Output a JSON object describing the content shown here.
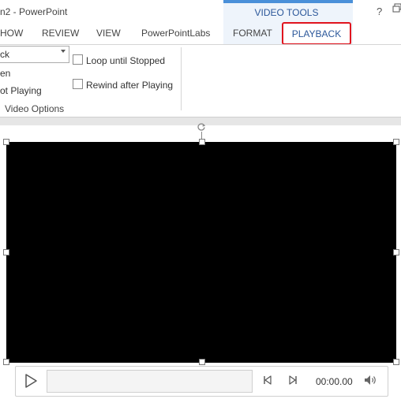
{
  "window": {
    "title": "n2 - PowerPoint",
    "contextual_group": "VIDEO TOOLS",
    "help": "?"
  },
  "tabs": [
    {
      "label": "HOW"
    },
    {
      "label": "REVIEW"
    },
    {
      "label": "VIEW"
    },
    {
      "label": "PowerPointLabs"
    },
    {
      "label": "FORMAT"
    },
    {
      "label": "PLAYBACK",
      "selected": true
    }
  ],
  "ribbon": {
    "start_dropdown_value": "ck",
    "fullscreen_label": "en",
    "hide_label": "ot Playing",
    "loop_label": "Loop until Stopped",
    "loop_checked": false,
    "rewind_label": "Rewind after Playing",
    "rewind_checked": false,
    "group_label": "Video Options"
  },
  "media": {
    "time": "00:00.00",
    "progress": 0
  },
  "colors": {
    "accent": "#2b579a",
    "highlight_box": "#e0141e",
    "video_background": "#000000"
  },
  "icons": {
    "play": "play-icon",
    "back": "step-back-icon",
    "forward": "step-forward-icon",
    "volume": "volume-icon",
    "rotate": "rotate-handle-icon",
    "restore": "restore-window-icon"
  }
}
